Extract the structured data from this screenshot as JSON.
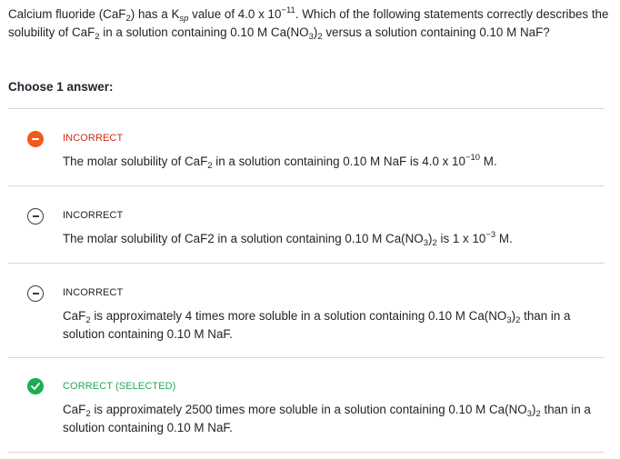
{
  "question": {
    "p1": "Calcium fluoride (CaF",
    "s1": "2",
    "p2": ") has a K",
    "s2": "sp",
    "p3": " value of 4.0 x 10",
    "s3": "−11",
    "p4": ". Which of the following statements correctly describes the solubility of CaF",
    "s4": "2",
    "p5": " in a solution containing 0.10 M Ca(NO",
    "s5": "3",
    "p6": ")",
    "s6": "2",
    "p7": " versus a solution containing 0.10 M NaF?"
  },
  "choose_label": "Choose 1 answer:",
  "choices": [
    {
      "status": "INCORRECT",
      "t1": "The molar solubility of CaF",
      "t1s": "2",
      "t2": " in a solution containing 0.10 M NaF is 4.0 x 10",
      "t2s": "−10",
      "t3": " M."
    },
    {
      "status": "INCORRECT",
      "t1": "The molar solubility of CaF2 in a solution containing 0.10 M Ca(NO",
      "t1s": "3",
      "t2": ")",
      "t2s": "2",
      "t3": " is 1 x 10",
      "t3s": "−3",
      "t4": " M."
    },
    {
      "status": "INCORRECT",
      "t1": "CaF",
      "t1s": "2",
      "t2": " is approximately 4 times more soluble in a solution containing 0.10 M Ca(NO",
      "t2s": "3",
      "t3": ")",
      "t3s": "2",
      "t4": " than in a solution containing 0.10 M NaF."
    },
    {
      "status": "CORRECT (SELECTED)",
      "t1": "CaF",
      "t1s": "2",
      "t2": " is approximately 2500 times more soluble in a solution containing 0.10 M Ca(NO",
      "t2s": "3",
      "t3": ")",
      "t3s": "2",
      "t4": " than in a solution containing 0.10 M NaF."
    }
  ],
  "icons": {
    "c0": "minus-circle-filled-icon",
    "c1": "minus-circle-outline-icon",
    "c2": "minus-circle-outline-icon",
    "c3": "checkmark-circle-icon"
  },
  "colors": {
    "incorrect_selected": "#f25a1d",
    "correct": "#1fab54",
    "divider": "#d6d8da",
    "text": "#21242c"
  }
}
